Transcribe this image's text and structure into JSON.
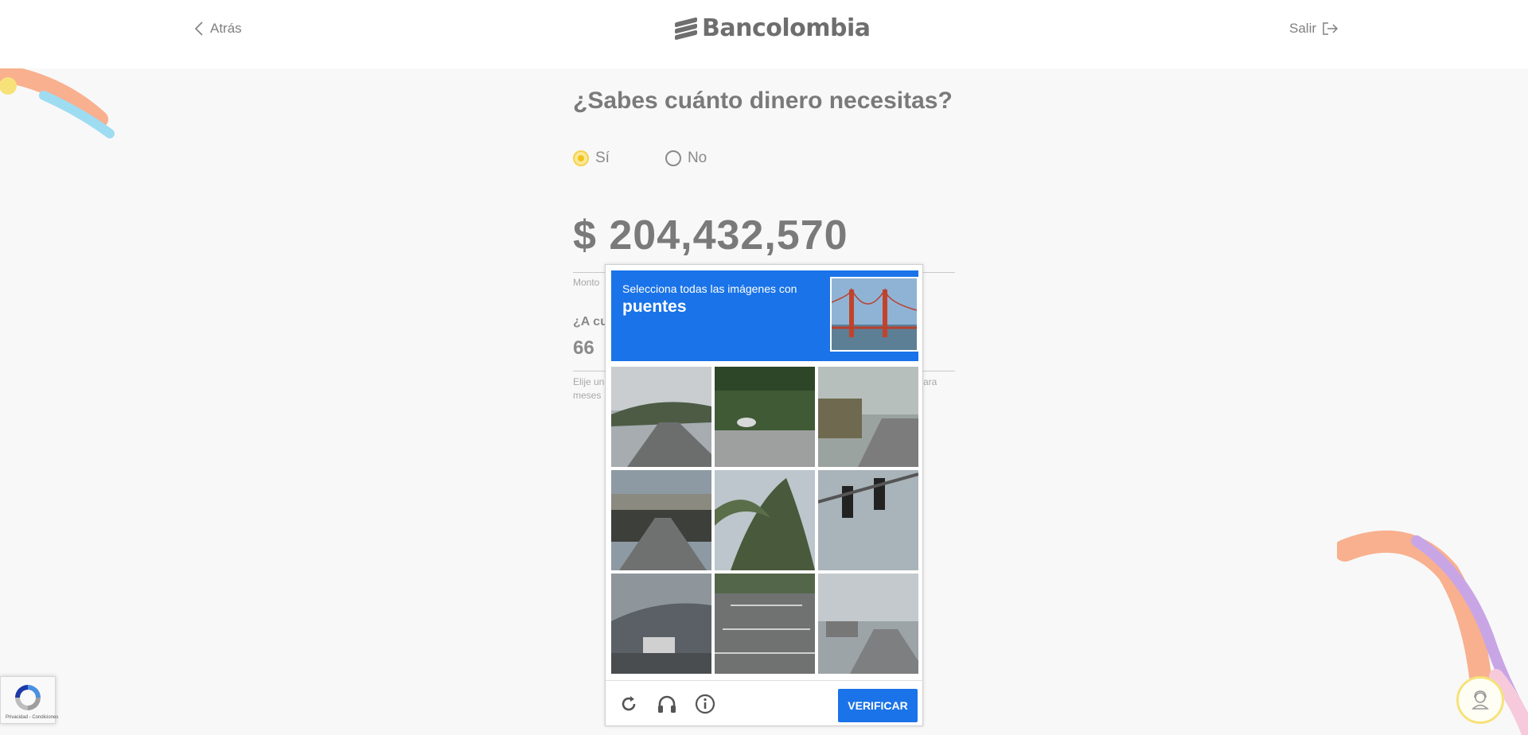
{
  "header": {
    "back_label": "Atrás",
    "logo_text": "Bancolombia",
    "exit_label": "Salir"
  },
  "form": {
    "question": "¿Sabes cuánto dinero necesitas?",
    "options": [
      {
        "label": "Sí",
        "selected": true
      },
      {
        "label": "No",
        "selected": false
      }
    ],
    "amount": "$ 204,432,570",
    "amount_help": "Monto",
    "term_label": "¿A cu",
    "term_value": "66",
    "term_help_left": "Elije un",
    "term_help_left2": "meses",
    "term_help_right": "ara"
  },
  "captcha": {
    "instruction": "Selecciona todas las imágenes con",
    "target": "puentes",
    "verify_label": "VERIFICAR",
    "reload_icon": "reload-icon",
    "audio_icon": "headphones-icon",
    "info_icon": "info-icon",
    "brand_color": "#1a73e8"
  },
  "badge": {
    "links": "Privacidad - Condiciones"
  },
  "colors": {
    "accent_yellow": "#f5d24a",
    "deco_orange": "#f8b08e",
    "deco_blue": "#9edcf2",
    "deco_purple": "#c8a6e6"
  }
}
